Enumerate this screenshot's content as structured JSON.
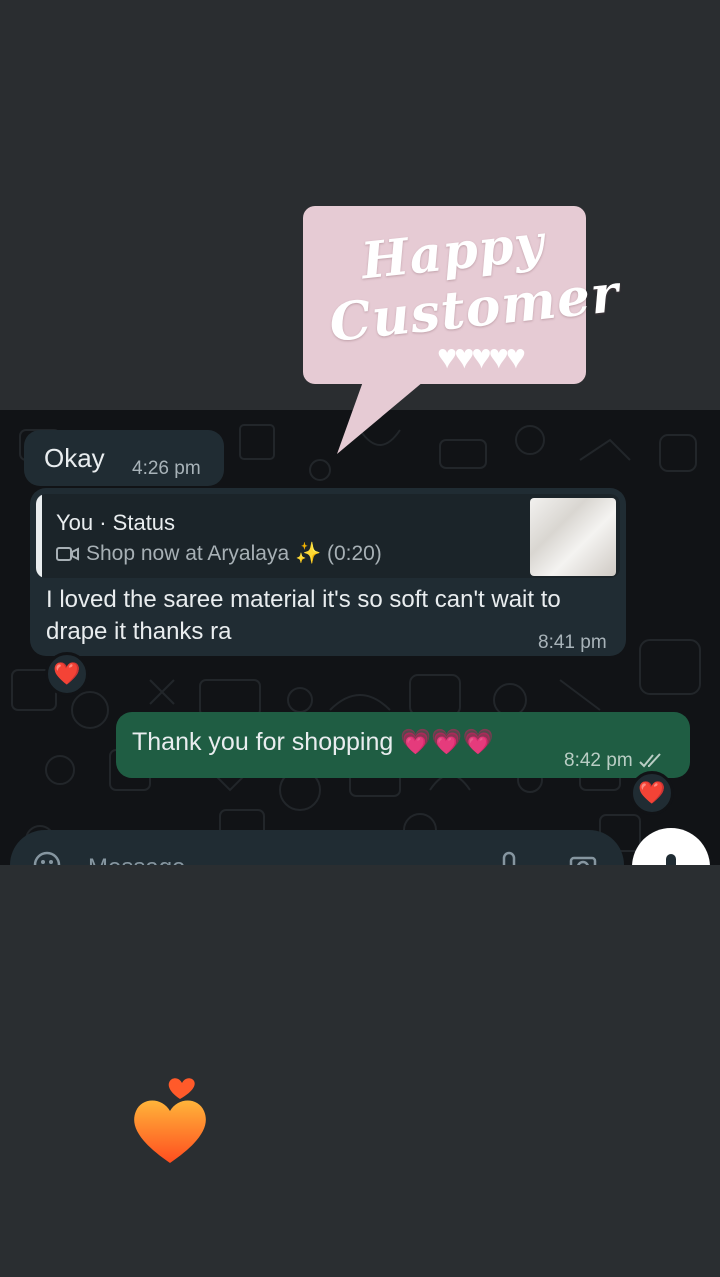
{
  "sticker": {
    "line1": "Happy",
    "line2": "Customer",
    "hearts": "♥♥♥♥♥"
  },
  "messages": [
    {
      "direction": "in",
      "text": "Okay",
      "time": "4:26 pm"
    },
    {
      "direction": "in",
      "quote": {
        "author": "You · Status",
        "line": "Shop now at Aryalaya ✨ (0:20)"
      },
      "text": "I loved the saree material it's so soft can't wait to drape it thanks ra",
      "time": "8:41 pm",
      "reaction": "❤️"
    },
    {
      "direction": "out",
      "text": "Thank you for shopping 💗💗💗",
      "time": "8:42 pm",
      "status": "read",
      "reaction": "❤️"
    }
  ],
  "input": {
    "placeholder": "Message"
  },
  "icons": [
    "emoji-icon",
    "attach-icon",
    "camera-icon",
    "mic-icon",
    "video-icon",
    "double-check-icon",
    "heart-sticker-icon"
  ],
  "colors": {
    "incoming_bubble": "#202c33",
    "outgoing_bubble": "#1f5d43",
    "sticker_bg": "#e6cbd4"
  }
}
